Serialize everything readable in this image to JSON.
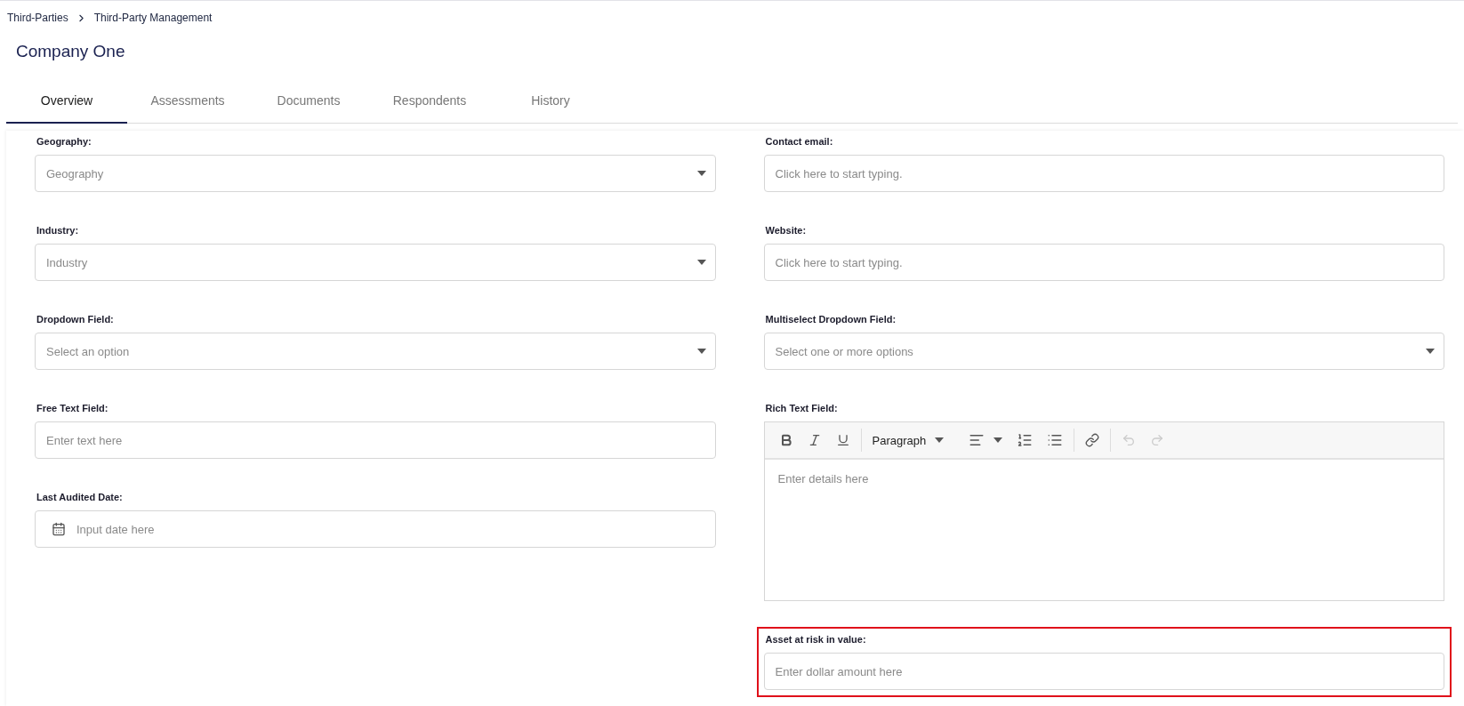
{
  "breadcrumb": [
    "Third-Parties",
    "Third-Party Management"
  ],
  "title": "Company One",
  "tabs": [
    {
      "label": "Overview",
      "selected": true
    },
    {
      "label": "Assessments",
      "selected": false
    },
    {
      "label": "Documents",
      "selected": false
    },
    {
      "label": "Respondents",
      "selected": false
    },
    {
      "label": "History",
      "selected": false
    }
  ],
  "left_fields": [
    {
      "label": "Geography:",
      "kind": "select",
      "placeholder": "Geography",
      "highlighted": false
    },
    {
      "label": "Industry:",
      "kind": "select",
      "placeholder": "Industry",
      "highlighted": false
    },
    {
      "label": "Dropdown Field:",
      "kind": "select",
      "placeholder": "Select an option",
      "highlighted": false
    },
    {
      "label": "Free Text Field:",
      "kind": "text",
      "placeholder": "Enter text here",
      "highlighted": false
    },
    {
      "label": "Last Audited Date:",
      "kind": "date",
      "placeholder": "Input date here",
      "highlighted": false
    }
  ],
  "right_fields": [
    {
      "label": "Contact email:",
      "kind": "text",
      "placeholder": "Click here to start typing.",
      "highlighted": false
    },
    {
      "label": "Website:",
      "kind": "text",
      "placeholder": "Click here to start typing.",
      "highlighted": false
    },
    {
      "label": "Multiselect Dropdown Field:",
      "kind": "select",
      "placeholder": "Select one or more options",
      "highlighted": false
    },
    {
      "label": "Rich Text Field:",
      "kind": "richtext",
      "placeholder": "Enter details here",
      "block_format": "Paragraph",
      "highlighted": false
    },
    {
      "label": "Asset at risk in value:",
      "kind": "text",
      "placeholder": "Enter dollar amount here",
      "highlighted": true
    }
  ]
}
